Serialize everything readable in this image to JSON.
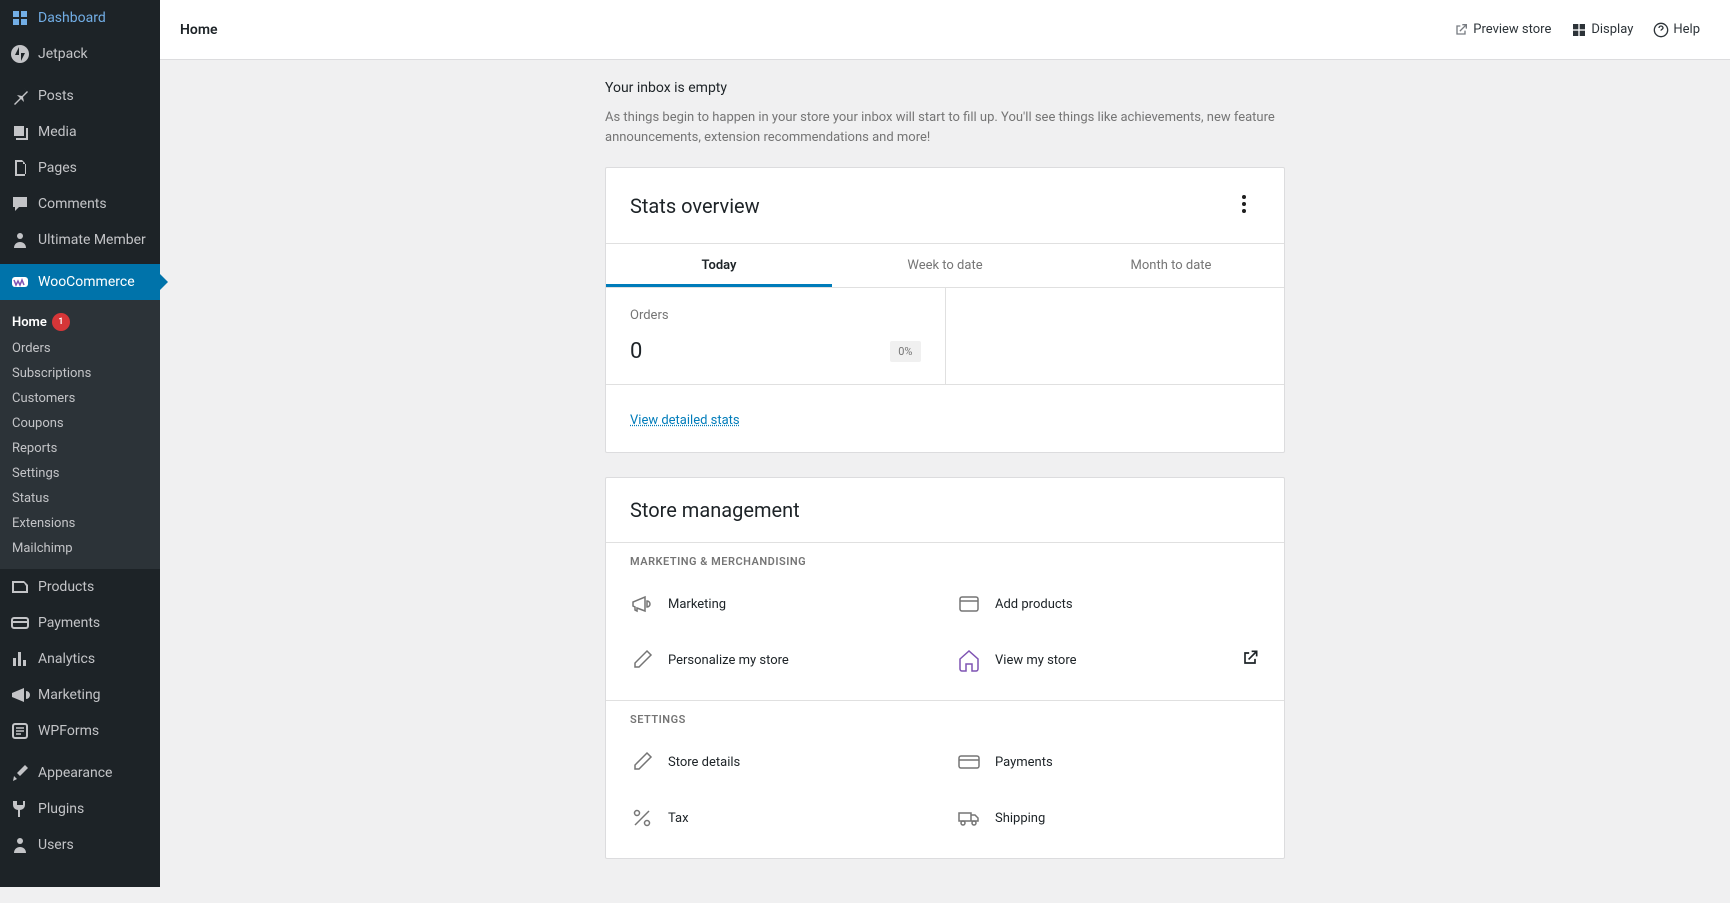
{
  "topbar": {
    "title": "Home",
    "preview_label": "Preview store",
    "display_label": "Display",
    "help_label": "Help"
  },
  "sidebar": {
    "top": [
      {
        "label": "Dashboard"
      },
      {
        "label": "Jetpack"
      }
    ],
    "mid": [
      {
        "label": "Posts"
      },
      {
        "label": "Media"
      },
      {
        "label": "Pages"
      },
      {
        "label": "Comments"
      },
      {
        "label": "Ultimate Member"
      }
    ],
    "woo_label": "WooCommerce",
    "sub": [
      {
        "label": "Home",
        "badge": "1"
      },
      {
        "label": "Orders"
      },
      {
        "label": "Subscriptions"
      },
      {
        "label": "Customers"
      },
      {
        "label": "Coupons"
      },
      {
        "label": "Reports"
      },
      {
        "label": "Settings"
      },
      {
        "label": "Status"
      },
      {
        "label": "Extensions"
      },
      {
        "label": "Mailchimp"
      }
    ],
    "bottom": [
      {
        "label": "Products"
      },
      {
        "label": "Payments"
      },
      {
        "label": "Analytics"
      },
      {
        "label": "Marketing"
      },
      {
        "label": "WPForms"
      }
    ],
    "bottom2": [
      {
        "label": "Appearance"
      },
      {
        "label": "Plugins"
      },
      {
        "label": "Users"
      }
    ]
  },
  "inbox": {
    "title": "Your inbox is empty",
    "desc": "As things begin to happen in your store your inbox will start to fill up. You'll see things like achievements, new feature announcements, extension recommendations and more!"
  },
  "stats": {
    "title": "Stats overview",
    "tabs": [
      {
        "label": "Today"
      },
      {
        "label": "Week to date"
      },
      {
        "label": "Month to date"
      }
    ],
    "cell": {
      "label": "Orders",
      "value": "0",
      "change": "0%"
    },
    "footer_link": "View detailed stats"
  },
  "mgmt": {
    "title": "Store management",
    "section1_label": "MARKETING & MERCHANDISING",
    "section2_label": "SETTINGS",
    "items1": [
      {
        "label": "Marketing"
      },
      {
        "label": "Add products"
      },
      {
        "label": "Personalize my store"
      },
      {
        "label": "View my store",
        "external": true
      }
    ],
    "items2": [
      {
        "label": "Store details"
      },
      {
        "label": "Payments"
      },
      {
        "label": "Tax"
      },
      {
        "label": "Shipping"
      }
    ]
  }
}
